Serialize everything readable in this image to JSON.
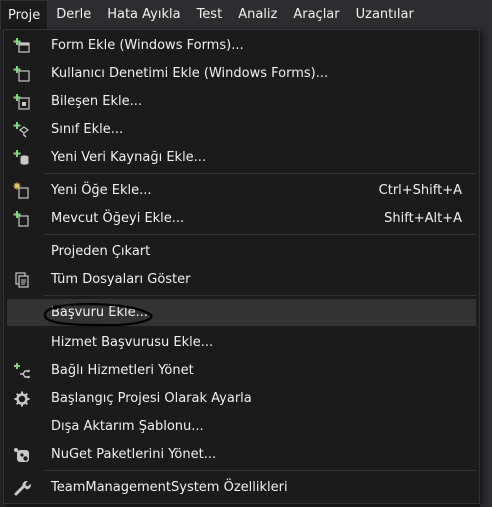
{
  "menubar": [
    "Proje",
    "Derle",
    "Hata Ayıkla",
    "Test",
    "Analiz",
    "Araçlar",
    "Uzantılar"
  ],
  "menu": {
    "items": [
      {
        "label": "Form Ekle (Windows Forms)...",
        "icon": "add-form-icon"
      },
      {
        "label": "Kullanıcı Denetimi Ekle (Windows Forms)...",
        "icon": "add-user-control-icon"
      },
      {
        "label": "Bileşen Ekle...",
        "icon": "add-component-icon"
      },
      {
        "label": "Sınıf Ekle...",
        "icon": "add-class-icon"
      },
      {
        "label": "Yeni Veri Kaynağı Ekle...",
        "icon": "add-data-source-icon"
      },
      {
        "label": "Yeni Öğe Ekle...",
        "shortcut": "Ctrl+Shift+A",
        "icon": "new-item-icon"
      },
      {
        "label": "Mevcut Öğeyi Ekle...",
        "shortcut": "Shift+Alt+A",
        "icon": "existing-item-icon"
      },
      {
        "label": "Projeden Çıkart",
        "icon": ""
      },
      {
        "label": "Tüm Dosyaları Göster",
        "icon": "show-all-files-icon"
      },
      {
        "label": "Başvuru Ekle...",
        "icon": ""
      },
      {
        "label": "Hizmet Başvurusu Ekle...",
        "icon": ""
      },
      {
        "label": "Bağlı Hizmetleri Yönet",
        "icon": "connected-services-icon"
      },
      {
        "label": "Başlangıç Projesi Olarak Ayarla",
        "icon": "gear-icon"
      },
      {
        "label": "Dışa Aktarım Şablonu...",
        "icon": ""
      },
      {
        "label": "NuGet Paketlerini Yönet...",
        "icon": "nuget-icon"
      },
      {
        "label": "TeamManagementSystem Özellikleri",
        "icon": "wrench-icon"
      }
    ]
  },
  "colors": {
    "accent": "#89d185",
    "menu_bg": "#1b1b1c",
    "highlight": "#333334",
    "text": "#f1f1f1"
  }
}
